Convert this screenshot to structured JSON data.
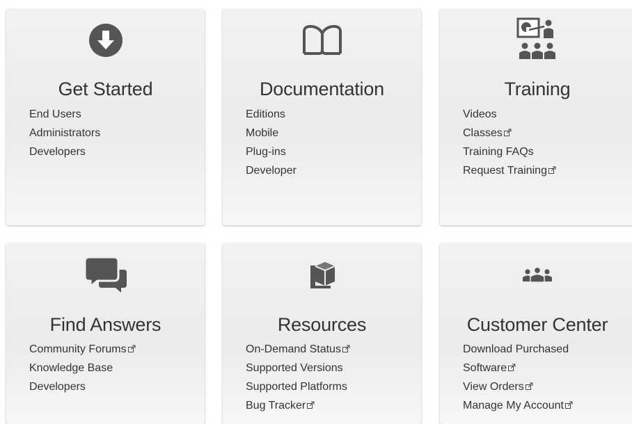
{
  "cards": [
    {
      "title": "Get Started",
      "icon": "download-arrow-icon",
      "links": [
        {
          "label": "End Users",
          "external": false
        },
        {
          "label": "Administrators",
          "external": false
        },
        {
          "label": "Developers",
          "external": false
        }
      ]
    },
    {
      "title": "Documentation",
      "icon": "open-book-icon",
      "links": [
        {
          "label": "Editions",
          "external": false
        },
        {
          "label": "Mobile",
          "external": false
        },
        {
          "label": "Plug-ins",
          "external": false
        },
        {
          "label": "Developer",
          "external": false
        }
      ]
    },
    {
      "title": "Training",
      "icon": "presentation-icon",
      "links": [
        {
          "label": "Videos",
          "external": false
        },
        {
          "label": "Classes",
          "external": true
        },
        {
          "label": "Training FAQs",
          "external": false
        },
        {
          "label": "Request Training",
          "external": true
        }
      ]
    },
    {
      "title": "Find Answers",
      "icon": "chat-bubbles-icon",
      "links": [
        {
          "label": "Community Forums",
          "external": true
        },
        {
          "label": "Knowledge Base",
          "external": false
        },
        {
          "label": "Developers",
          "external": false
        }
      ]
    },
    {
      "title": "Resources",
      "icon": "package-cube-icon",
      "links": [
        {
          "label": "On-Demand Status",
          "external": true
        },
        {
          "label": "Supported Versions",
          "external": false
        },
        {
          "label": "Supported Platforms",
          "external": false
        },
        {
          "label": "Bug Tracker",
          "external": true
        }
      ]
    },
    {
      "title": "Customer Center",
      "icon": "user-group-icon",
      "links": [
        {
          "label": "Download Purchased",
          "external": false
        },
        {
          "label": "Software",
          "external": true
        },
        {
          "label": "View Orders",
          "external": true
        },
        {
          "label": "Manage My Account",
          "external": true
        }
      ]
    }
  ],
  "colors": {
    "icon": "#555555",
    "text": "#333333",
    "card_bg": "#efefef"
  }
}
